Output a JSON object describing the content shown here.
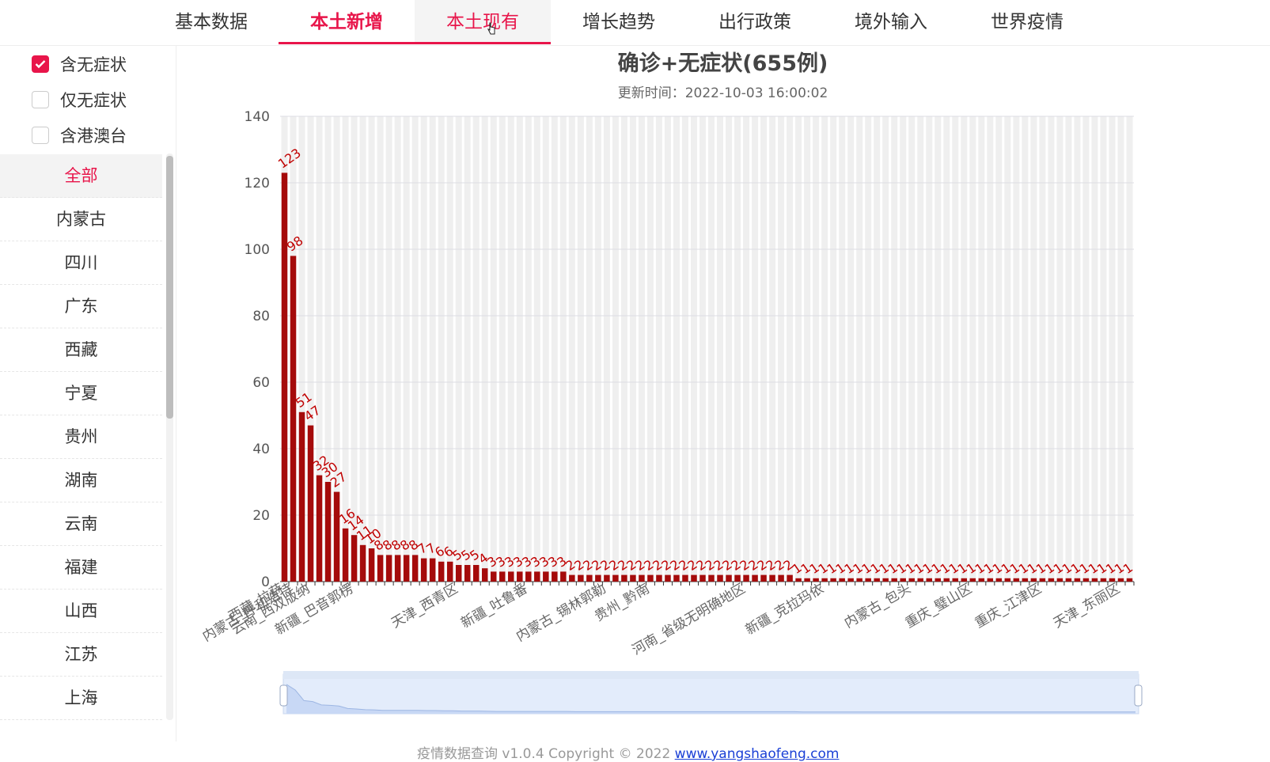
{
  "nav": {
    "tabs": [
      {
        "label": "基本数据",
        "state": ""
      },
      {
        "label": "本土新增",
        "state": "active"
      },
      {
        "label": "本土现有",
        "state": "hover"
      },
      {
        "label": "增长趋势",
        "state": ""
      },
      {
        "label": "出行政策",
        "state": ""
      },
      {
        "label": "境外输入",
        "state": ""
      },
      {
        "label": "世界疫情",
        "state": ""
      }
    ]
  },
  "filters": [
    {
      "label": "含无症状",
      "checked": true
    },
    {
      "label": "仅无症状",
      "checked": false
    },
    {
      "label": "含港澳台",
      "checked": false
    }
  ],
  "regions": {
    "items": [
      "全部",
      "内蒙古",
      "四川",
      "广东",
      "西藏",
      "宁夏",
      "贵州",
      "湖南",
      "云南",
      "福建",
      "山西",
      "江苏",
      "上海"
    ],
    "selected": 0
  },
  "colors": {
    "accent": "#e8154a",
    "bar": "#a50b0b",
    "label": "#c00000",
    "link": "#1a3fd6"
  },
  "chart_data": {
    "type": "bar",
    "title": "确诊+无症状(655例)",
    "subtitle": "更新时间：2022-10-03 16:00:02",
    "ylim": [
      0,
      140
    ],
    "yticks": [
      0,
      20,
      40,
      60,
      80,
      100,
      120,
      140
    ],
    "grid": true,
    "values": [
      123,
      98,
      51,
      47,
      32,
      30,
      27,
      16,
      14,
      11,
      10,
      8,
      8,
      8,
      8,
      8,
      7,
      7,
      6,
      6,
      5,
      5,
      5,
      4,
      3,
      3,
      3,
      3,
      3,
      3,
      3,
      3,
      3,
      2,
      2,
      2,
      2,
      2,
      2,
      2,
      2,
      2,
      2,
      2,
      2,
      2,
      2,
      2,
      2,
      2,
      2,
      2,
      2,
      2,
      2,
      2,
      2,
      2,
      2,
      1,
      1,
      1,
      1,
      1,
      1,
      1,
      1,
      1,
      1,
      1,
      1,
      1,
      1,
      1,
      1,
      1,
      1,
      1,
      1,
      1,
      1,
      1,
      1,
      1,
      1,
      1,
      1,
      1,
      1,
      1,
      1,
      1,
      1,
      1,
      1,
      1,
      1,
      1
    ],
    "visible_category_labels": [
      {
        "index": 0,
        "label": "西藏_拉萨"
      },
      {
        "index": 1,
        "label": "内蒙古_呼和浩特"
      },
      {
        "index": 3,
        "label": "云南_西双版纳"
      },
      {
        "index": 8,
        "label": "新疆_巴音郭楞"
      },
      {
        "index": 20,
        "label": "天津_西青区"
      },
      {
        "index": 28,
        "label": "新疆_吐鲁番"
      },
      {
        "index": 37,
        "label": "内蒙古_锡林郭勒"
      },
      {
        "index": 42,
        "label": "贵州_黔南"
      },
      {
        "index": 53,
        "label": "河南_省级无明确地区"
      },
      {
        "index": 62,
        "label": "新疆_克拉玛依"
      },
      {
        "index": 72,
        "label": "内蒙古_包头"
      },
      {
        "index": 79,
        "label": "重庆_璧山区"
      },
      {
        "index": 87,
        "label": "重庆_江津区"
      },
      {
        "index": 96,
        "label": "天津_东丽区"
      }
    ]
  },
  "footer": {
    "text": "疫情数据查询 v1.0.4 Copyright © 2022 ",
    "link": "www.yangshaofeng.com"
  }
}
